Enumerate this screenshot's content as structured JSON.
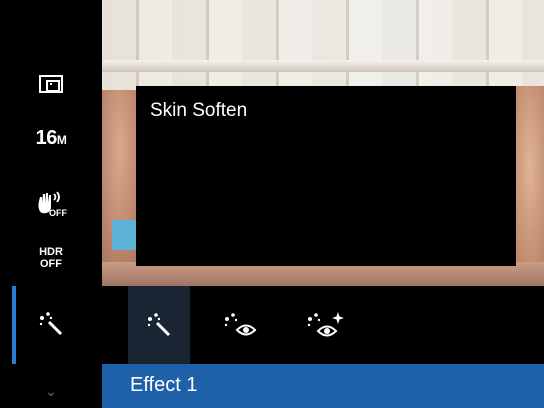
{
  "left_menu": {
    "items": [
      {
        "name": "metering-icon"
      },
      {
        "resolution_value": "16",
        "resolution_unit": "M"
      },
      {
        "name": "image-stabilizer-icon",
        "sub": "OFF"
      },
      {
        "hdr_line1": "HDR",
        "hdr_line2": "OFF"
      },
      {
        "name": "magic-wand-icon"
      }
    ],
    "more_icon": "chevron-down-icon"
  },
  "info_panel": {
    "title": "Skin Soften"
  },
  "options": {
    "items": [
      {
        "name": "skin-soften-icon"
      },
      {
        "name": "eye-enhance-icon"
      },
      {
        "name": "eye-sparkle-icon"
      }
    ]
  },
  "selected_label": "Effect 1",
  "colors": {
    "accent": "#1f61a8",
    "indicator": "#2a7fd0"
  }
}
